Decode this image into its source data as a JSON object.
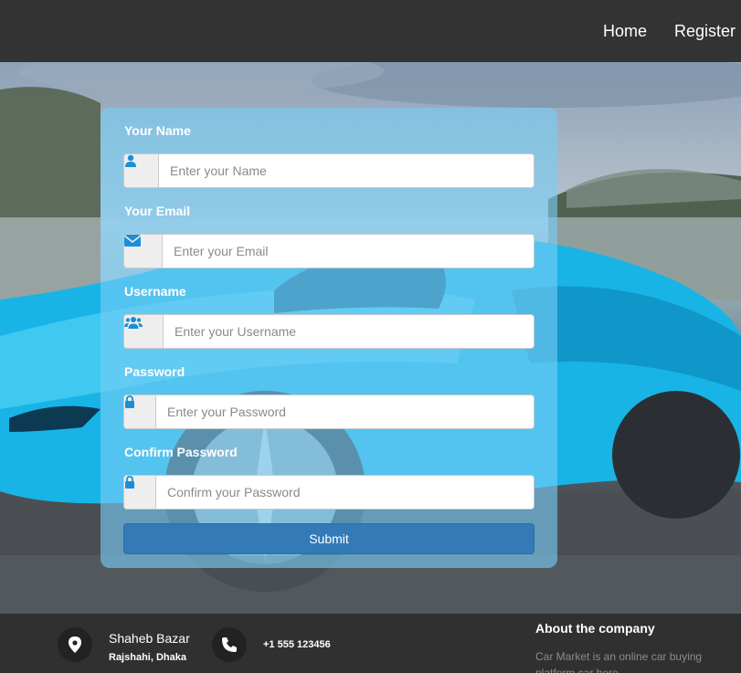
{
  "nav": {
    "home": "Home",
    "register": "Register"
  },
  "form": {
    "name_label": "Your Name",
    "name_placeholder": "Enter your Name",
    "email_label": "Your Email",
    "email_placeholder": "Enter your Email",
    "username_label": "Username",
    "username_placeholder": "Enter your Username",
    "password_label": "Password",
    "password_placeholder": "Enter your Password",
    "confirm_label": "Confirm Password",
    "confirm_placeholder": "Confirm your Password",
    "submit_label": "Submit"
  },
  "footer": {
    "address_line1": "Shaheb Bazar",
    "address_line2": "Rajshahi, Dhaka",
    "phone": "+1 555 123456",
    "about_title": "About the company",
    "about_text": "Car Market is an online car buying platform car here"
  },
  "icons": [
    "user-icon",
    "envelope-icon",
    "users-icon",
    "lock-icon",
    "map-marker-icon",
    "phone-icon"
  ],
  "colors": {
    "header": "#333333",
    "accent": "#337ab7",
    "icon": "#1a8fd8",
    "panel": "#78cdf5"
  }
}
